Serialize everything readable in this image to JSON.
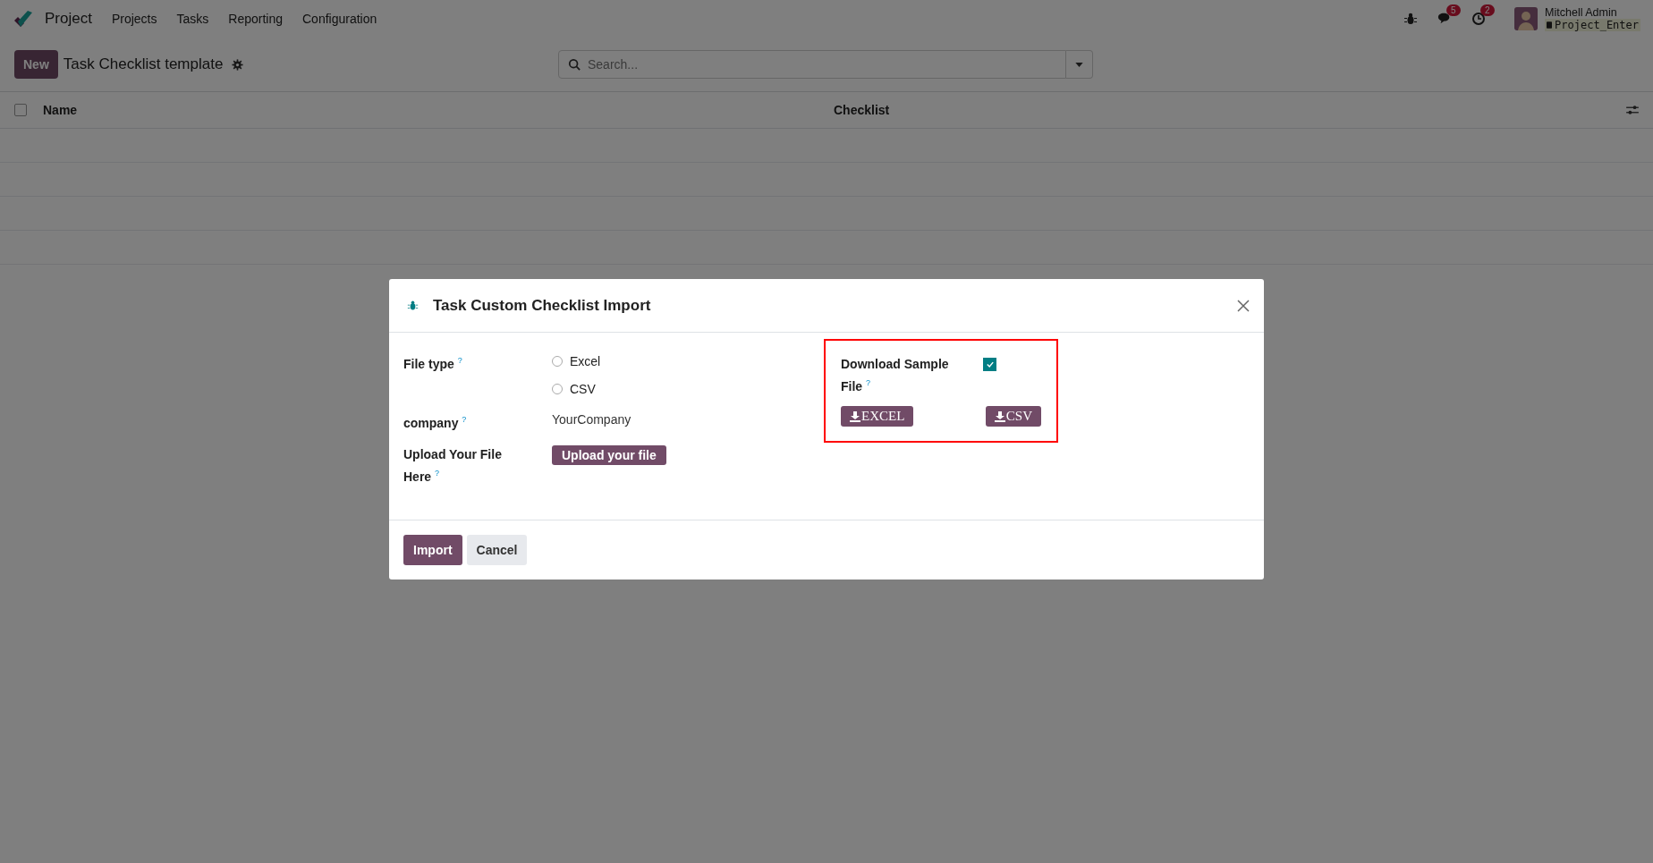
{
  "navbar": {
    "app_name": "Project",
    "menu": [
      "Projects",
      "Tasks",
      "Reporting",
      "Configuration"
    ],
    "messages_count": "5",
    "activities_count": "2",
    "user_name": "Mitchell Admin",
    "database": "Project_Enter"
  },
  "control_panel": {
    "new_button": "New",
    "title": "Task Checklist template",
    "search": {
      "placeholder": "Search..."
    }
  },
  "list": {
    "select_all": {
      "checked": false
    },
    "columns": [
      "Name",
      "Checklist"
    ]
  },
  "dialog": {
    "title": "Task Custom Checklist Import",
    "file_type": {
      "label": "File type $^{?}$",
      "options": [
        {
          "label": "Excel",
          "selected": false
        },
        {
          "label": "CSV",
          "selected": false
        }
      ]
    },
    "company": {
      "label": "company $^{?}$",
      "value": "YourCompany"
    },
    "upload": {
      "label": "Upload Your File Here $^{?}$",
      "button": "Upload your file"
    },
    "download_sample": {
      "label": "Download Sample File $^{?}$",
      "checked": true,
      "buttons": [
        "EXCEL",
        "CSV"
      ]
    },
    "footer_buttons": [
      {
        "label": "Import",
        "kind": "primary"
      },
      {
        "label": "Cancel",
        "kind": "secondary"
      }
    ]
  }
}
